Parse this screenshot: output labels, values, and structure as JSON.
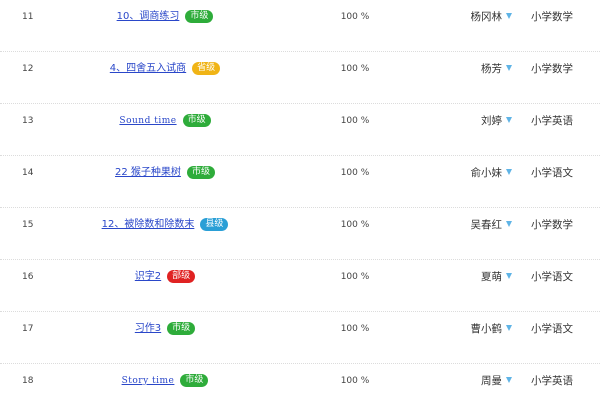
{
  "colors": {
    "city": "#2eac3a",
    "province": "#f0b416",
    "county": "#2a9fd6",
    "ministry": "#e02222",
    "link": "#2a47c9",
    "filter": "#5fb4e6"
  },
  "rows": [
    {
      "num": "11",
      "title": "10、调商练习",
      "badge": "市级",
      "badge_type": "city",
      "rate": "100 %",
      "teacher": "杨冈林",
      "subject": "小学数学"
    },
    {
      "num": "12",
      "title": "4、四舍五入试商",
      "badge": "省级",
      "badge_type": "province",
      "rate": "100 %",
      "teacher": "杨芳",
      "subject": "小学数学"
    },
    {
      "num": "13",
      "title": "Sound time",
      "badge": "市级",
      "badge_type": "city",
      "rate": "100 %",
      "teacher": "刘婷",
      "subject": "小学英语"
    },
    {
      "num": "14",
      "title": "22 猴子种果树",
      "badge": "市级",
      "badge_type": "city",
      "rate": "100 %",
      "teacher": "俞小妹",
      "subject": "小学语文"
    },
    {
      "num": "15",
      "title": "12、被除数和除数末",
      "badge": "县级",
      "badge_type": "county",
      "rate": "100 %",
      "teacher": "吴春红",
      "subject": "小学数学"
    },
    {
      "num": "16",
      "title": "识字2",
      "badge": "部级",
      "badge_type": "ministry",
      "rate": "100 %",
      "teacher": "夏萌",
      "subject": "小学语文"
    },
    {
      "num": "17",
      "title": "习作3",
      "badge": "市级",
      "badge_type": "city",
      "rate": "100 %",
      "teacher": "曹小鹤",
      "subject": "小学语文"
    },
    {
      "num": "18",
      "title": "Story time",
      "badge": "市级",
      "badge_type": "city",
      "rate": "100 %",
      "teacher": "周曼",
      "subject": "小学英语"
    }
  ]
}
